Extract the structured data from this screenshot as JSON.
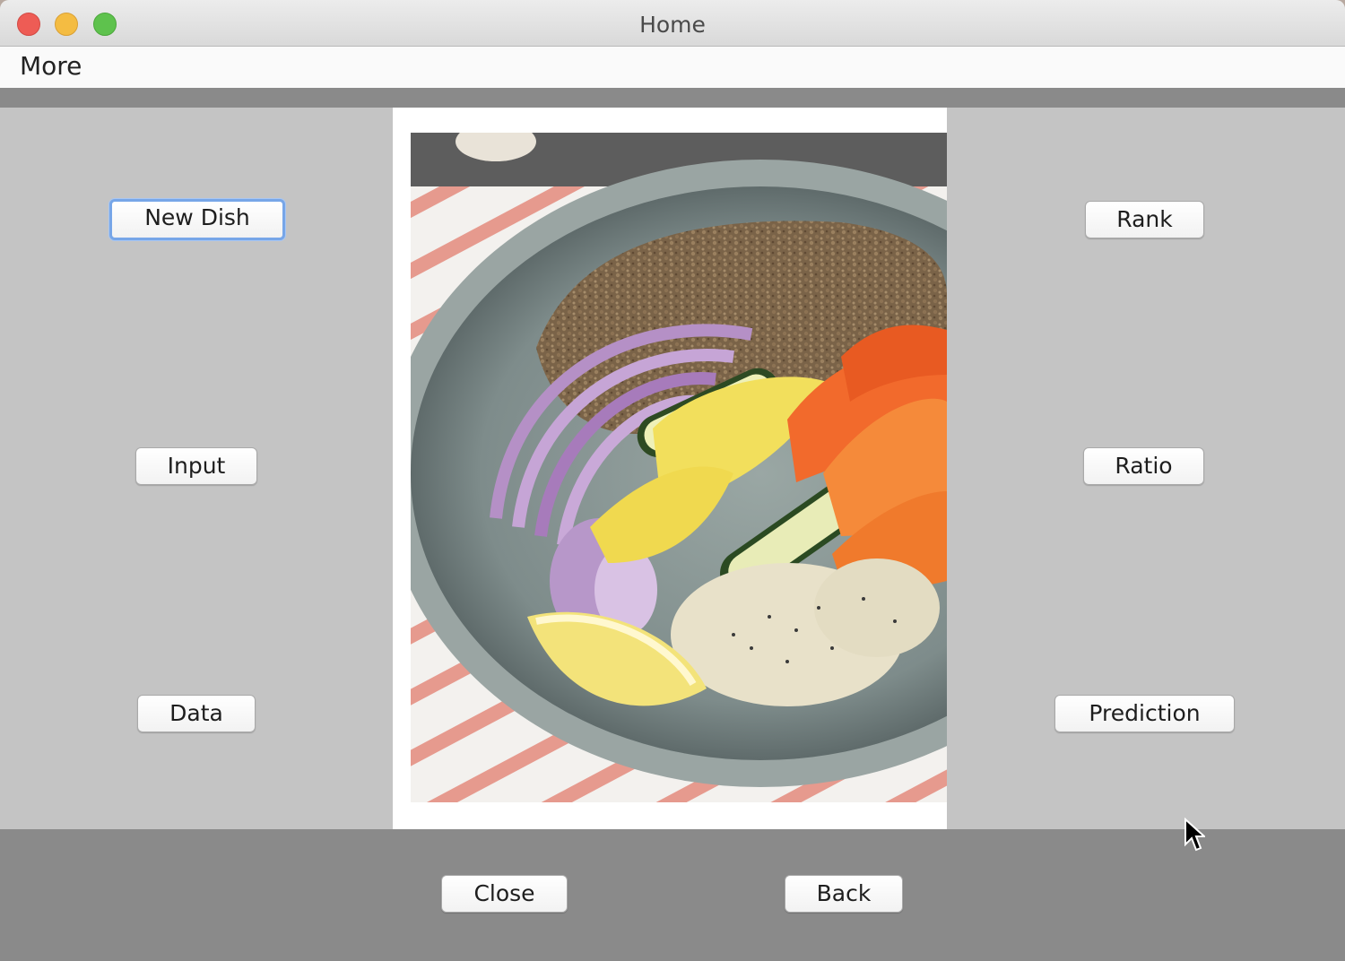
{
  "window": {
    "title": "Home"
  },
  "menu": {
    "items": [
      "More"
    ]
  },
  "left_buttons": {
    "new_dish": "New Dish",
    "input": "Input",
    "data": "Data"
  },
  "right_buttons": {
    "rank": "Rank",
    "ratio": "Ratio",
    "prediction": "Prediction"
  },
  "bottom_buttons": {
    "close": "Close",
    "back": "Back"
  },
  "colors": {
    "panel": "#c4c4c4",
    "strip": "#8a8a8a",
    "focus_ring": "#77a6e8"
  }
}
